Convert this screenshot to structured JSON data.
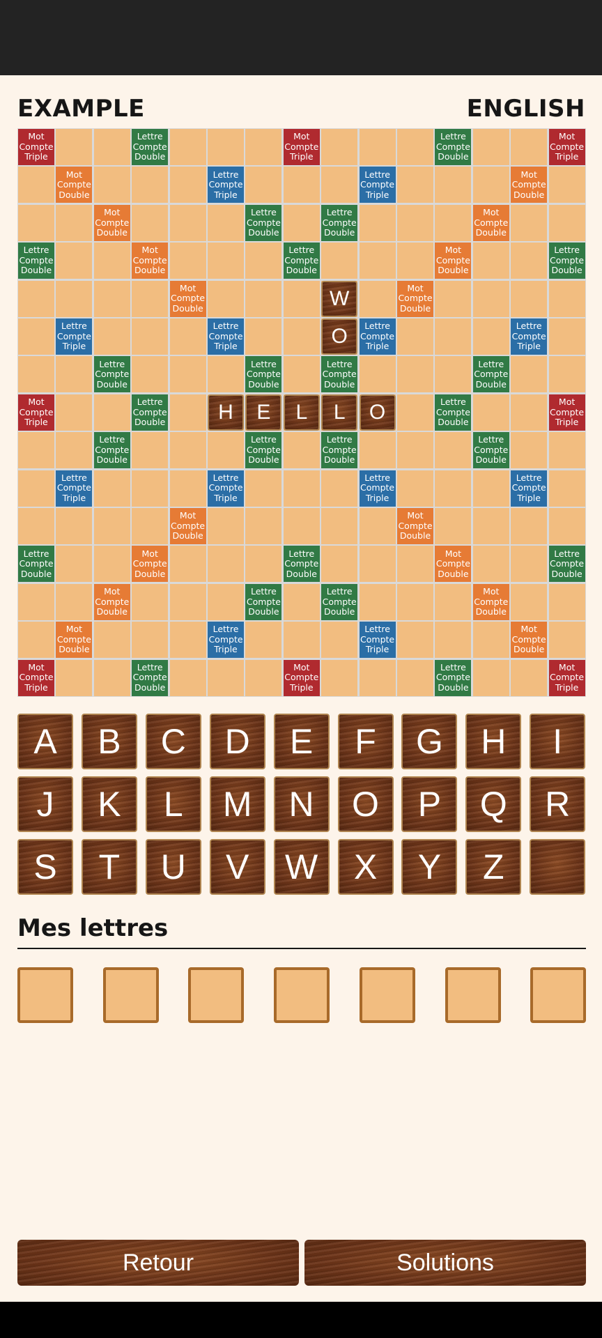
{
  "header": {
    "title": "EXAMPLE",
    "language": "ENGLISH"
  },
  "premium_labels": {
    "tw": "Mot\nCompte\nTriple",
    "dw": "Mot\nCompte\nDouble",
    "tl": "Lettre\nCompte\nTriple",
    "dl": "Lettre\nCompte\nDouble"
  },
  "board": {
    "rows": [
      "T..d...T...d..T",
      ".D...t...t...D.",
      "..D...d.d...D..",
      "d..D...d...D..d",
      "....D.....D....",
      ".t...t...t...t.",
      "..d...d.d...d..",
      "T..d.......d..T",
      "..d...d.d...d..",
      ".t...t...t...t.",
      "....D.....D....",
      "d..D...d...D..d",
      "..D...d.d...D..",
      ".D...t...t...D.",
      "T..d...T...d..T"
    ],
    "placed_tiles": [
      {
        "row": 4,
        "col": 8,
        "letter": "W"
      },
      {
        "row": 5,
        "col": 8,
        "letter": "O"
      },
      {
        "row": 7,
        "col": 5,
        "letter": "H"
      },
      {
        "row": 7,
        "col": 6,
        "letter": "E"
      },
      {
        "row": 7,
        "col": 7,
        "letter": "L"
      },
      {
        "row": 7,
        "col": 8,
        "letter": "L"
      },
      {
        "row": 7,
        "col": 9,
        "letter": "O"
      }
    ]
  },
  "keyboard": {
    "keys": [
      "A",
      "B",
      "C",
      "D",
      "E",
      "F",
      "G",
      "H",
      "I",
      "J",
      "K",
      "L",
      "M",
      "N",
      "O",
      "P",
      "Q",
      "R",
      "S",
      "T",
      "U",
      "V",
      "W",
      "X",
      "Y",
      "Z",
      ""
    ]
  },
  "rack": {
    "title": "Mes lettres",
    "slots": [
      "",
      "",
      "",
      "",
      "",
      "",
      ""
    ]
  },
  "buttons": {
    "back": "Retour",
    "solutions": "Solutions"
  }
}
